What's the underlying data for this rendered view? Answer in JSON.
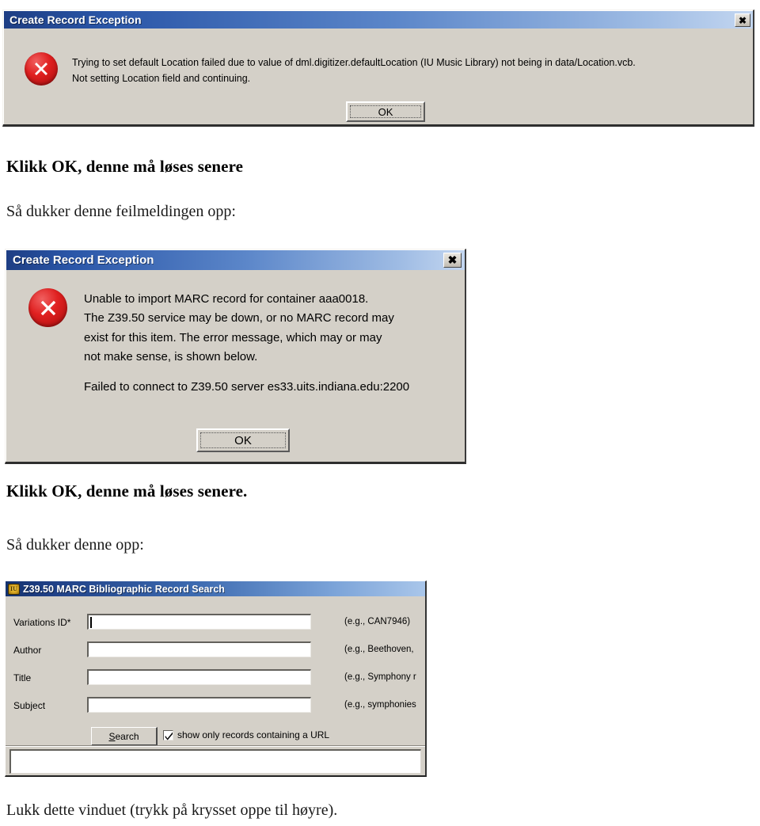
{
  "colors": {
    "dialog_face": "#d4d0c8",
    "titlebar_dark_blue": "#1e3e84",
    "titlebar_light_blue": "#c3d6f0",
    "error_red": "#e02020",
    "text_black": "#000000"
  },
  "dialog1": {
    "title": "Create Record Exception",
    "close_label": "✖",
    "icon": "error-x-icon",
    "message_lines": [
      "Trying to set default Location failed due to value of dml.digitizer.defaultLocation (IU Music Library) not being in data/Location.vcb.",
      "Not setting Location field and continuing."
    ],
    "ok_label": "OK"
  },
  "note1": "Klikk OK, denne må løses senere",
  "note2": "Så dukker denne feilmeldingen opp:",
  "dialog2": {
    "title": "Create Record Exception",
    "close_label": "✖",
    "icon": "error-x-icon",
    "message_lines": [
      "Unable to import MARC record for container aaa0018.",
      "The Z39.50 service may be down, or no MARC record may",
      "exist for this item. The error message, which may or may",
      "not make sense, is shown below."
    ],
    "detail_line": "Failed to connect to Z39.50 server es33.uits.indiana.edu:2200",
    "ok_label": "OK"
  },
  "note3": "Klikk OK, denne må løses senere.",
  "note4": "Så dukker denne opp:",
  "search_window": {
    "title": "Z39.50 MARC Bibliographic Record Search",
    "app_icon": "iu-crest-icon",
    "icon_glyph": "IU",
    "fields": [
      {
        "label": "Variations ID*",
        "value": "",
        "placeholder": "",
        "hint": "(e.g., CAN7946)"
      },
      {
        "label": "Author",
        "value": "",
        "placeholder": "",
        "hint": "(e.g., Beethoven,"
      },
      {
        "label": "Title",
        "value": "",
        "placeholder": "",
        "hint": "(e.g., Symphony r"
      },
      {
        "label": "Subject",
        "value": "",
        "placeholder": "",
        "hint": "(e.g., symphonies"
      }
    ],
    "search_button": {
      "mnemonic": "S",
      "rest": "earch"
    },
    "checkbox": {
      "label": "show only records containing a URL",
      "checked": true
    },
    "results_text": ""
  },
  "note5": "Lukk dette vinduet (trykk på krysset oppe til høyre)."
}
